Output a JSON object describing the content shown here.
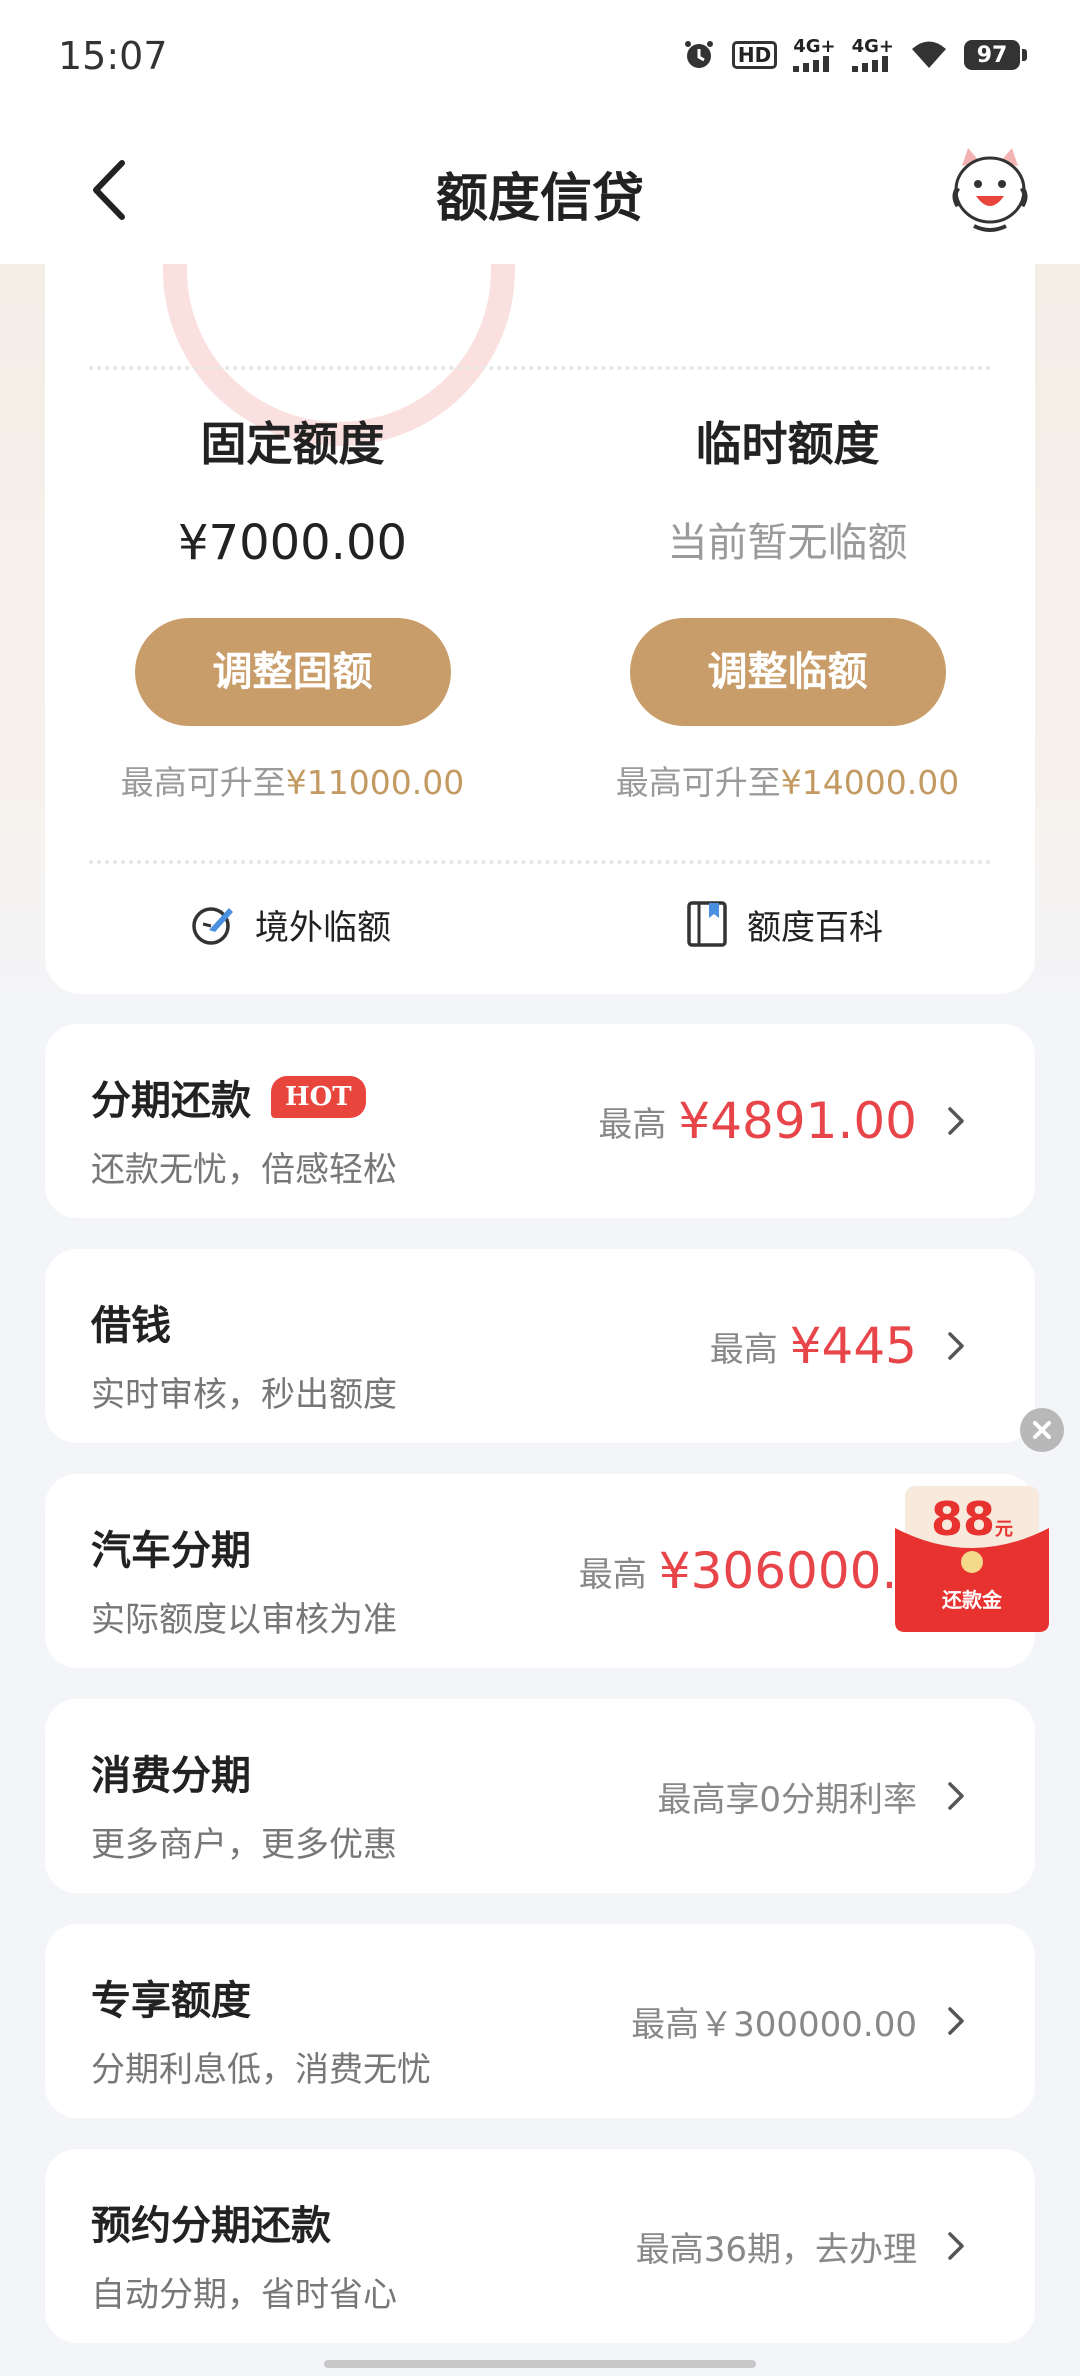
{
  "status_bar": {
    "time": "15:07",
    "hd_label": "HD",
    "net1_label": "4G+",
    "net2_label": "4G+",
    "battery": "97",
    "icons": [
      "alarm-icon",
      "hd-icon",
      "signal-icon",
      "signal-icon",
      "wifi-icon",
      "battery-icon"
    ]
  },
  "header": {
    "title": "额度信贷",
    "back_icon": "chevron-left-icon",
    "mascot_icon": "mascot-avatar-icon"
  },
  "quota": {
    "fixed": {
      "title": "固定额度",
      "amount": "¥7000.00",
      "button": "调整固额",
      "hint_prefix": "最高可升至",
      "hint_amount": "¥11000.00"
    },
    "temp": {
      "title": "临时额度",
      "status": "当前暂无临额",
      "button": "调整临额",
      "hint_prefix": "最高可升至",
      "hint_amount": "¥14000.00"
    },
    "links": [
      {
        "label": "境外临额",
        "icon": "plane-globe-icon"
      },
      {
        "label": "额度百科",
        "icon": "book-icon"
      }
    ]
  },
  "services": [
    {
      "title": "分期还款",
      "badge": "HOT",
      "subtitle": "还款无忧，倍感轻松",
      "prefix": "最高",
      "amount": "¥4891.00"
    },
    {
      "title": "借钱",
      "subtitle": "实时审核，秒出额度",
      "prefix": "最高",
      "amount": "¥445"
    },
    {
      "title": "汽车分期",
      "subtitle": "实际额度以审核为准",
      "prefix": "最高",
      "amount": "¥306000.00"
    },
    {
      "title": "消费分期",
      "subtitle": "更多商户，更多优惠",
      "plain": "最高享0分期利率"
    },
    {
      "title": "专享额度",
      "subtitle": "分期利息低，消费无忧",
      "plain": "最高￥300000.00"
    },
    {
      "title": "预约分期还款",
      "subtitle": "自动分期，省时省心",
      "plain": "最高36期，去办理"
    }
  ],
  "float_badge": {
    "amount": "88",
    "unit": "元",
    "label": "还款金"
  },
  "colors": {
    "gold": "#c89d69",
    "red": "#e8454a",
    "hot": "#e8453c"
  }
}
